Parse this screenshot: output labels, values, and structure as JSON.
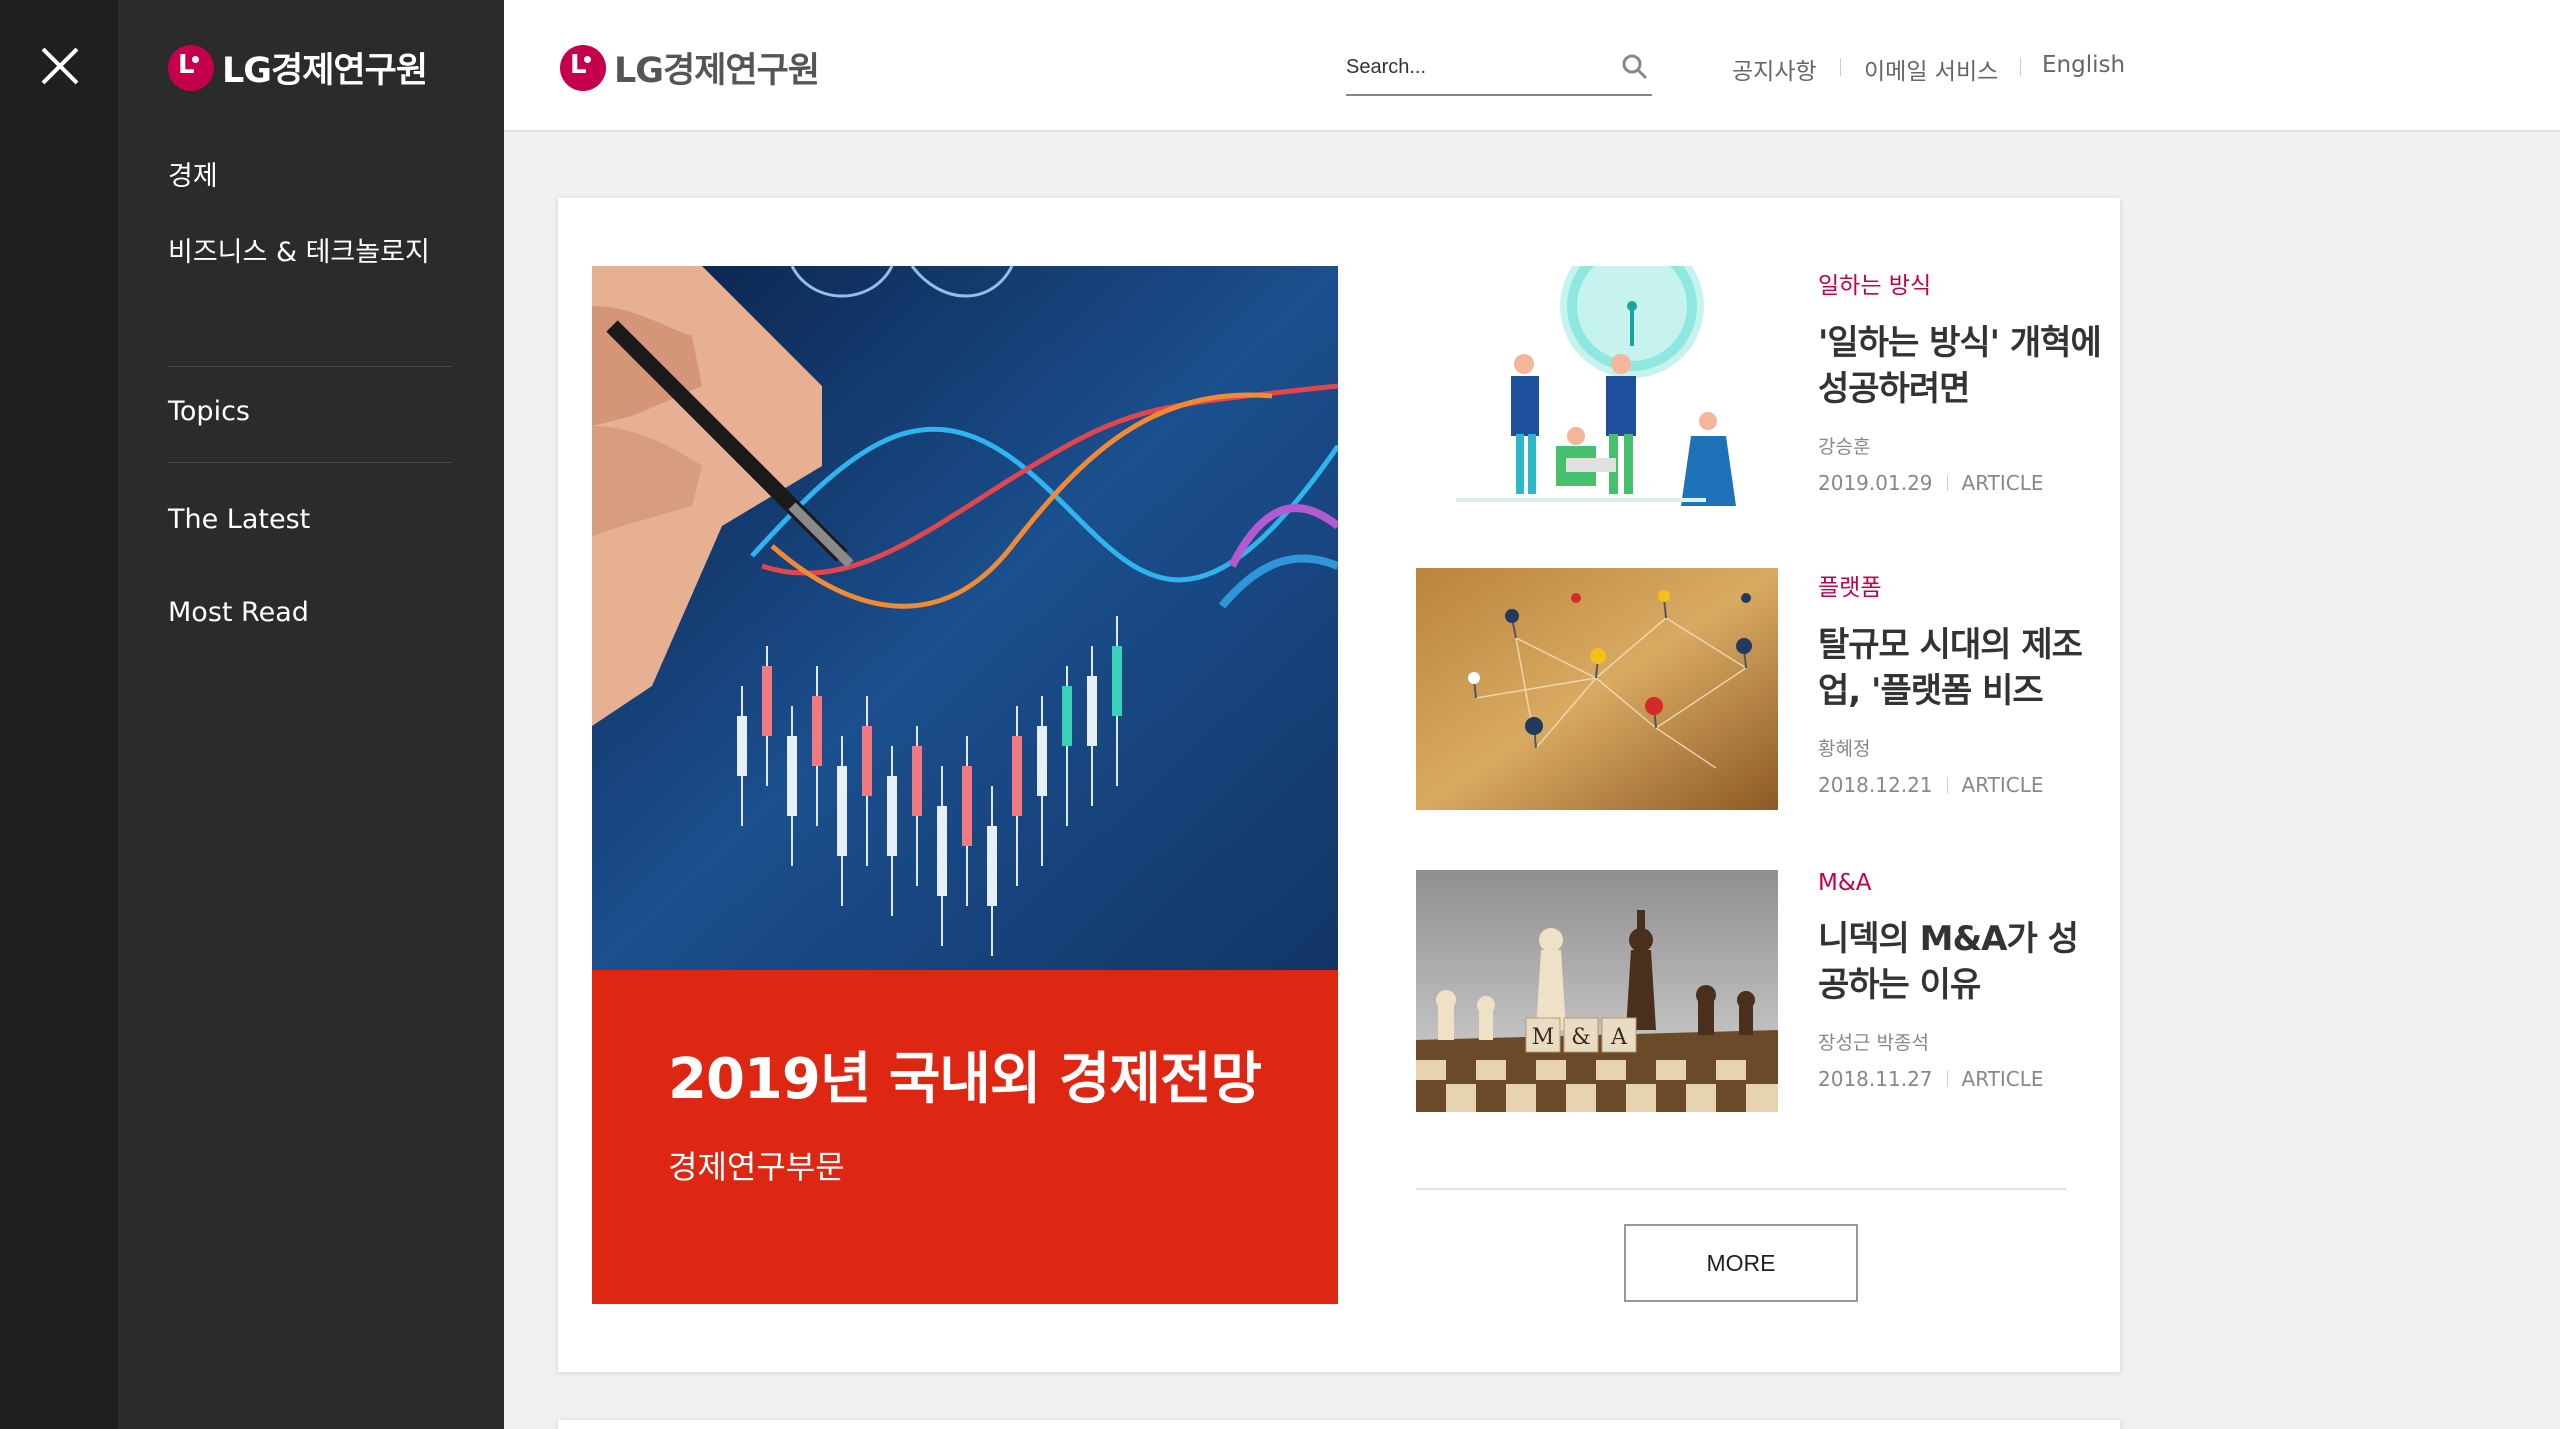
{
  "side_menu": {
    "close_label": "×",
    "logo_text": "LG경제연구원",
    "items": [
      {
        "label": "경제"
      },
      {
        "label": "비즈니스 & 테크놀로지"
      },
      {
        "label": "Topics"
      },
      {
        "label": "The Latest"
      },
      {
        "label": "Most Read"
      }
    ]
  },
  "header": {
    "logo_text": "LG경제연구원",
    "search": {
      "placeholder": "Search..."
    },
    "links": [
      {
        "label": "공지사항"
      },
      {
        "label": "이메일 서비스"
      },
      {
        "label": "English"
      }
    ]
  },
  "feature": {
    "title": "2019년 국내외 경제전망",
    "subtitle": "경제연구부문"
  },
  "articles": [
    {
      "category": "일하는 방식",
      "title": "'일하는 방식' 개혁에 성공하려면",
      "author": "강승훈",
      "date": "2019.01.29",
      "type": "ARTICLE"
    },
    {
      "category": "플랫폼",
      "title": "탈규모 시대의 제조업, '플랫폼 비즈니...",
      "author": "황혜정",
      "date": "2018.12.21",
      "type": "ARTICLE"
    },
    {
      "category": "M&A",
      "title": "니덱의 M&A가 성공하는 이유",
      "author": "장성근 박종석",
      "date": "2018.11.27",
      "type": "ARTICLE"
    }
  ],
  "more_button": "MORE",
  "colors": {
    "brand": "#c4004d",
    "feature_red": "#de2712",
    "menu_bg": "#2b2b2b"
  }
}
